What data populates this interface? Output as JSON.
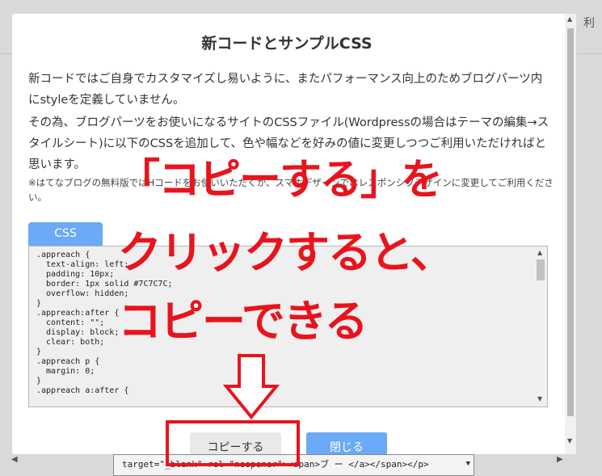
{
  "background": {
    "right_edge_char": "利",
    "bottom_field_text": "target=\"_blank\" rel=\"noopener\"><span>ブ ー </a></span></p>"
  },
  "modal": {
    "title": "新コードとサンプルCSS",
    "paragraph1": "新コードではご自身でカスタマイズし易いように、またパフォーマンス向上のためブログパーツ内にstyleを定義していません。",
    "paragraph2": "その為、ブログパーツをお使いになるサイトのCSSファイル(Wordpressの場合はテーマの編集→スタイルシート)に以下のCSSを追加して、色や幅などを好みの値に変更しつつご利用いただければと思います。",
    "note": "※はてなブログの無料版ではHコードをお使いいただくか、スマホデザインではレスポンシブデザインに変更してご利用ください。",
    "css_tab_label": "CSS",
    "code_lines": [
      ".appreach {",
      "  text-align: left;",
      "  padding: 10px;",
      "  border: 1px solid #7C7C7C;",
      "  overflow: hidden;",
      "}",
      ".appreach:after {",
      "  content: \"\";",
      "  display: block;",
      "  clear: both;",
      "}",
      ".appreach p {",
      "  margin: 0;",
      "}",
      ".appreach a:after {"
    ],
    "copy_button_label": "コピーする",
    "close_button_label": "閉じる"
  },
  "annotation": {
    "line1": "「コピーする」を",
    "line2": "クリックすると、",
    "line3": "コピーできる",
    "color": "#e8141d"
  },
  "colors": {
    "accent_blue": "#6aaaf6",
    "overlay_gray": "#d9d9d9"
  }
}
